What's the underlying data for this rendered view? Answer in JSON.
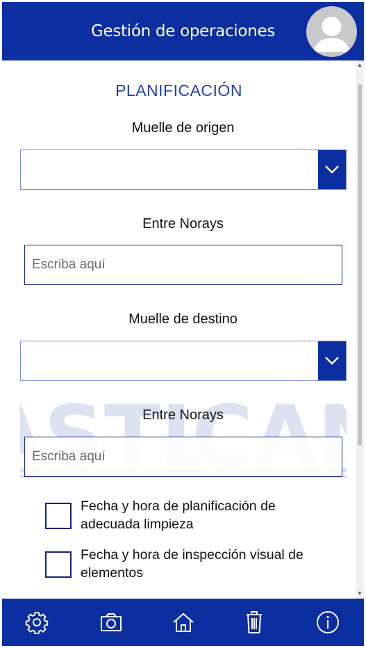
{
  "header": {
    "title": "Gestión de operaciones",
    "avatar_icon": "user-avatar-icon"
  },
  "form": {
    "section_title": "PLANIFICACIÓN",
    "origin_label": "Muelle de origen",
    "origin_value": "",
    "origin_norays_label": "Entre Norays",
    "origin_norays_placeholder": "Escriba aquí",
    "destination_label": "Muelle de destino",
    "destination_value": "",
    "destination_norays_label": "Entre Norays",
    "destination_norays_placeholder": "Escriba aquí",
    "checks": [
      {
        "label": "Fecha y hora de planificación de adecuada limpieza",
        "checked": false
      },
      {
        "label": "Fecha y hora de inspección visual de elementos",
        "checked": false
      }
    ]
  },
  "watermark_text": "ASTICAN",
  "bottom_nav": [
    {
      "icon": "gear-icon"
    },
    {
      "icon": "camera-icon"
    },
    {
      "icon": "home-icon"
    },
    {
      "icon": "trash-icon"
    },
    {
      "icon": "info-icon"
    }
  ],
  "colors": {
    "primary": "#0b2ea0",
    "accent_text": "#1a3eb3",
    "input_border": "#14227a",
    "watermark": "#dde2f1"
  }
}
